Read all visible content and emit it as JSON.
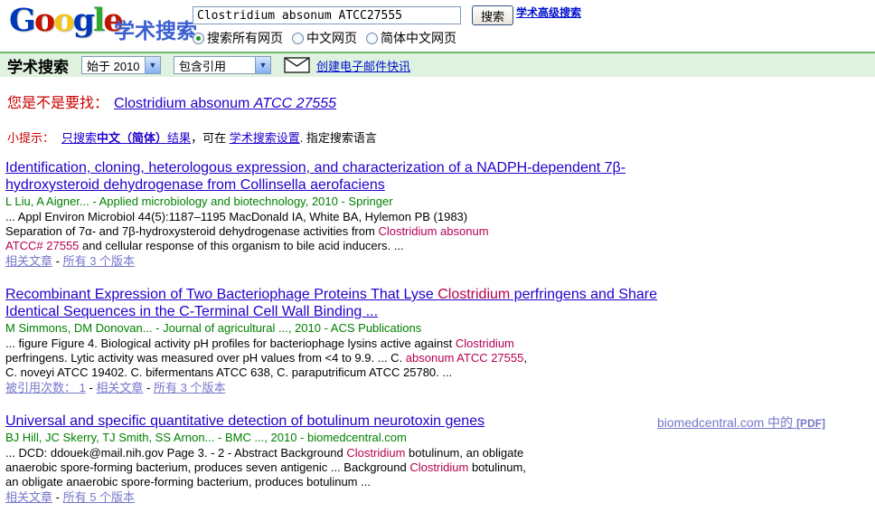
{
  "colors": {
    "link_blue": "#2200CC",
    "highlight_red": "#B60050",
    "author_green": "#008000",
    "notice_red": "#CC0000",
    "visited_purple": "#7777CC",
    "bar_green": "#DFF2DF"
  },
  "header": {
    "logo": {
      "letters": [
        {
          "ch": "G",
          "color": "#0039B6"
        },
        {
          "ch": "o",
          "color": "#C41200"
        },
        {
          "ch": "o",
          "color": "#F3C518"
        },
        {
          "ch": "g",
          "color": "#0039B6"
        },
        {
          "ch": "l",
          "color": "#30A72F"
        },
        {
          "ch": "e",
          "color": "#C41200"
        }
      ],
      "cn_title": "学术搜索"
    },
    "search": {
      "query": "Clostridium absonum ATCC27555",
      "button_label": "搜索",
      "advanced_link": "学术高级搜索"
    },
    "radios": [
      {
        "label": "搜索所有网页",
        "selected": true
      },
      {
        "label": "中文网页",
        "selected": false
      },
      {
        "label": "简体中文网页",
        "selected": false
      }
    ]
  },
  "toolbar": {
    "title": "学术搜索",
    "year_dropdown": "始于 2010",
    "citation_dropdown": "包含引用",
    "alert_link": "创建电子邮件快讯"
  },
  "did_you_mean": {
    "label": "您是不是要找：",
    "suggestion_plain": "Clostridium absonum ",
    "suggestion_italic": "ATCC 27555"
  },
  "tip": {
    "label": "小提示：",
    "link1_pre": "只搜索",
    "link1_bold": "中文（简体）",
    "link1_post": "结果",
    "mid": "，可在 ",
    "settings_link": "学术搜索设置",
    "post": ". 指定搜索语言"
  },
  "footer_separator": " - ",
  "results": [
    {
      "title_segments": [
        {
          "t": "Identification, cloning, heterologous expression, and characterization of a NADPH-dependent 7β-"
        },
        {
          "br": true
        },
        {
          "t": "hydroxysteroid dehydrogenase from Collinsella aerofaciens"
        }
      ],
      "authors": "L Liu, A Aigner... - Applied microbiology and biotechnology, 2010 - Springer",
      "snippet_segments": [
        {
          "t": "... Appl Environ Microbiol 44(5):1187–1195 MacDonald IA, White BA, Hylemon PB (1983)"
        },
        {
          "br": true
        },
        {
          "t": "Separation of 7α- and 7β-hydroxysteroid dehydrogenase activities from "
        },
        {
          "t": "Clostridium absonum",
          "h": true
        },
        {
          "br": true
        },
        {
          "t": "ATCC# 27555",
          "h": true
        },
        {
          "t": " and cellular response of this organism to bile acid inducers. ..."
        }
      ],
      "footer_links": [
        "相关文章",
        "所有 3 个版本"
      ]
    },
    {
      "title_segments": [
        {
          "t": "Recombinant Expression of Two Bacteriophage Proteins That Lyse "
        },
        {
          "t": "Clostridium",
          "h": true
        },
        {
          "t": " perfringens and Share"
        },
        {
          "br": true
        },
        {
          "t": "Identical Sequences in the C-Terminal Cell Wall Binding ..."
        }
      ],
      "authors": "M Simmons, DM Donovan... - Journal of agricultural ..., 2010 - ACS Publications",
      "snippet_segments": [
        {
          "t": "... figure Figure 4. Biological activity pH profiles for bacteriophage lysins active against "
        },
        {
          "t": "Clostridium",
          "h": true
        },
        {
          "br": true
        },
        {
          "t": "perfringens. Lytic activity was measured over pH values from <4 to 9.9. ... C. "
        },
        {
          "t": "absonum ATCC 27555",
          "h": true
        },
        {
          "t": ","
        },
        {
          "br": true
        },
        {
          "t": "C. noveyi ATCC 19402. C. bifermentans ATCC 638, C. paraputrificum ATCC 25780. ..."
        }
      ],
      "footer_links": [
        "被引用次数： 1",
        "相关文章",
        "所有 3 个版本"
      ]
    },
    {
      "title_segments": [
        {
          "t": "Universal and specific quantitative detection of botulinum neurotoxin genes"
        }
      ],
      "authors": "BJ Hill, JC Skerry, TJ Smith, SS Arnon... - BMC ..., 2010 - biomedcentral.com",
      "snippet_segments": [
        {
          "t": "... DCD: ddouek@mail.nih.gov Page 3. - 2 - Abstract Background "
        },
        {
          "t": "Clostridium",
          "h": true
        },
        {
          "t": " botulinum, an obligate"
        },
        {
          "br": true
        },
        {
          "t": "anaerobic spore-forming bacterium, produces seven antigenic ... Background "
        },
        {
          "t": "Clostridium",
          "h": true
        },
        {
          "t": " botulinum,"
        },
        {
          "br": true
        },
        {
          "t": "an obligate anaerobic spore-forming bacterium, produces botulinum ..."
        }
      ],
      "footer_links": [
        "相关文章",
        "所有 5 个版本"
      ],
      "side_link": {
        "text": "biomedcentral.com 中的 ",
        "pdf": "[PDF]"
      }
    }
  ]
}
